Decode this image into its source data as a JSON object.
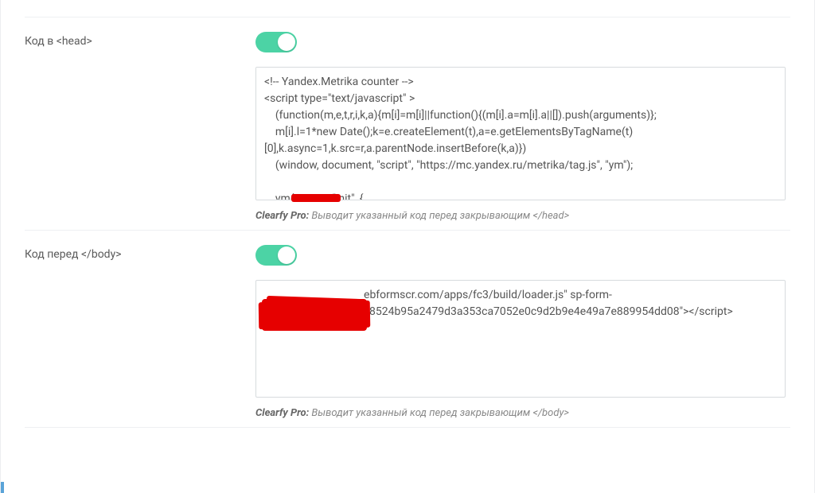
{
  "sections": {
    "head": {
      "label_prefix": "Код в ",
      "label_tag": "<head>",
      "toggle_on": true,
      "code": "<!-- Yandex.Metrika counter -->\n<script type=\"text/javascript\" >\n    (function(m,e,t,r,i,k,a){m[i]=m[i]||function(){(m[i].a=m[i].a||[]).push(arguments)};\n    m[i].l=1*new Date();k=e.createElement(t),a=e.getElementsByTagName(t)\n[0],k.async=1,k.src=r,a.parentNode.insertBefore(k,a)})\n    (window, document, \"script\", \"https://mc.yandex.ru/metrika/tag.js\", \"ym\");\n\n    ym(            , \"init\", {",
      "hint_brand": "Clearfy Pro:",
      "hint_text": " Выводит указанный код перед закрывающим ",
      "hint_tag": "</head>"
    },
    "body": {
      "label_prefix": "Код перед ",
      "label_tag": "</body>",
      "toggle_on": true,
      "code": "                                    ebformscr.com/apps/fc3/build/loader.js\" sp-form-\n                                      8524b95a2479d3a353ca7052e0c9d2b9e4e49a7e889954dd08\"></script>",
      "hint_brand": "Clearfy Pro:",
      "hint_text": " Выводит указанный код перед закрывающим ",
      "hint_tag": "</body>"
    }
  }
}
